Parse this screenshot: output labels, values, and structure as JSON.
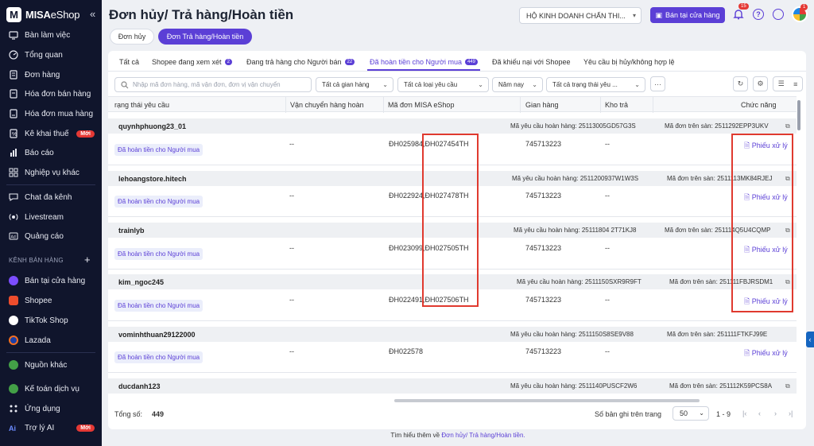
{
  "app": {
    "logo_mark": "M",
    "logo_name": "MISA",
    "logo_suffix": "eShop",
    "collapse_icon": "«"
  },
  "sidebar": {
    "items": [
      {
        "label": "Bàn làm việc",
        "icon": "desk-icon"
      },
      {
        "label": "Tổng quan",
        "icon": "gauge-icon"
      },
      {
        "label": "Đơn hàng",
        "icon": "order-icon"
      },
      {
        "label": "Hóa đơn bán hàng",
        "icon": "invoice-icon"
      },
      {
        "label": "Hóa đơn mua hàng",
        "icon": "purchase-invoice-icon"
      },
      {
        "label": "Kê khai thuế",
        "icon": "tax-icon",
        "badge": "Mới"
      },
      {
        "label": "Báo cáo",
        "icon": "chart-icon"
      },
      {
        "label": "Nghiệp vụ khác",
        "icon": "grid-icon"
      },
      {
        "label": "Chat đa kênh",
        "icon": "chat-icon"
      },
      {
        "label": "Livestream",
        "icon": "livestream-icon"
      },
      {
        "label": "Quảng cáo",
        "icon": "ads-icon"
      }
    ],
    "section_label": "KÊNH BÁN HÀNG",
    "section_plus": "+",
    "channels": [
      {
        "label": "Bán tại cửa hàng",
        "color": "#7c4dff"
      },
      {
        "label": "Shopee",
        "color": "#ee4d2d"
      },
      {
        "label": "TikTok Shop",
        "color": "#ffffff"
      },
      {
        "label": "Lazada",
        "color": "#1a3fa8"
      }
    ],
    "bottom_items": [
      {
        "label": "Nguồn khác",
        "icon": "source-icon",
        "color": "#43a047"
      },
      {
        "label": "Kế toán dịch vụ",
        "icon": "accounting-icon",
        "color": "#43a047"
      },
      {
        "label": "Ứng dụng",
        "icon": "apps-icon"
      },
      {
        "label": "Trợ lý AI",
        "icon": "ai-icon",
        "badge": "Mới"
      }
    ]
  },
  "header": {
    "title": "Đơn hủy/ Trả hàng/Hoàn tiền",
    "store_select": "HỘ KINH DOANH CHẤN THI...",
    "shop_button": "Bán tại cửa hàng",
    "bell_count": "15",
    "help_icon": "?",
    "avatar_badge": "1"
  },
  "top_tabs": [
    {
      "label": "Đơn hủy",
      "active": false
    },
    {
      "label": "Đơn Trả hàng/Hoàn tiền",
      "active": true
    }
  ],
  "sub_tabs": [
    {
      "label": "Tất cả"
    },
    {
      "label": "Shopee đang xem xét",
      "count": "2"
    },
    {
      "label": "Đang trả hàng cho Người bán",
      "count": "22"
    },
    {
      "label": "Đã hoàn tiền cho Người mua",
      "count": "449",
      "active": true
    },
    {
      "label": "Đã khiếu nại với Shopee"
    },
    {
      "label": "Yêu cầu bị hủy/không hợp lệ"
    }
  ],
  "filters": {
    "search_placeholder": "Nhập mã đơn hàng, mã vận đơn, đơn vị vận chuyển",
    "store": "Tất cả gian hàng",
    "request_type": "Tất cả loại yêu cầu",
    "period": "Năm nay",
    "status": "Tất cả trạng thái yêu ...",
    "more": "···"
  },
  "table": {
    "columns": [
      "rạng thái yêu cầu",
      "Vận chuyển hàng hoàn",
      "Mã đơn MISA eShop",
      "Gian hàng",
      "Kho trả",
      "Chức năng"
    ],
    "req_label": "Mã yêu cầu hoàn hàng:",
    "ord_label": "Mã đơn trên sàn:",
    "groups": [
      {
        "buyer": "quynhphuong23_01",
        "request_code": "25113005GD57G3S",
        "platform_order": "2511292EPP3UKV",
        "status": "Đã hoàn tiền cho Người mua",
        "shipping": "--",
        "misa_order": "ĐH025984,ĐH027454TH",
        "store": "745713223",
        "warehouse": "--",
        "action": "Phiếu xử lý"
      },
      {
        "buyer": "lehoangstore.hitech",
        "request_code": "2511200937W1W3S",
        "platform_order": "2511113MK84RJEJ",
        "status": "Đã hoàn tiền cho Người mua",
        "shipping": "--",
        "misa_order": "ĐH022924,ĐH027478TH",
        "store": "745713223",
        "warehouse": "--",
        "action": "Phiếu xử lý"
      },
      {
        "buyer": "trainlyb",
        "request_code": "25111804 2T71KJ8",
        "platform_order": "251114Q5U4CQMP",
        "status": "Đã hoàn tiền cho Người mua",
        "shipping": "--",
        "misa_order": "ĐH023099,ĐH027505TH",
        "store": "745713223",
        "warehouse": "--",
        "action": "Phiếu xử lý"
      },
      {
        "buyer": "kim_ngoc245",
        "request_code": "2511150SXR9R9FT",
        "platform_order": "251111FBJRSDM1",
        "status": "Đã hoàn tiền cho Người mua",
        "shipping": "--",
        "misa_order": "ĐH022491,ĐH027506TH",
        "store": "745713223",
        "warehouse": "--",
        "action": "Phiếu xử lý"
      },
      {
        "buyer": "vominhthuan29122000",
        "request_code": "2511150S8SE9V88",
        "platform_order": "251111FTKFJ99E",
        "status": "Đã hoàn tiền cho Người mua",
        "shipping": "--",
        "misa_order": "ĐH022578",
        "store": "745713223",
        "warehouse": "--",
        "action": "Phiếu xử lý"
      },
      {
        "buyer": "ducdanh123",
        "request_code": "2511140PUSCF2W6",
        "platform_order": "251112K59PCS8A",
        "status": "",
        "shipping": "",
        "misa_order": "",
        "store": "",
        "warehouse": "",
        "action": ""
      }
    ]
  },
  "pagination": {
    "total_label": "Tổng số:",
    "total": "449",
    "per_page_label": "Số bản ghi trên trang",
    "per_page": "50",
    "range": "1 - 9"
  },
  "footer": {
    "prefix": "Tìm hiểu thêm về ",
    "link": "Đơn hủy/ Trả hàng/Hoàn tiền."
  }
}
